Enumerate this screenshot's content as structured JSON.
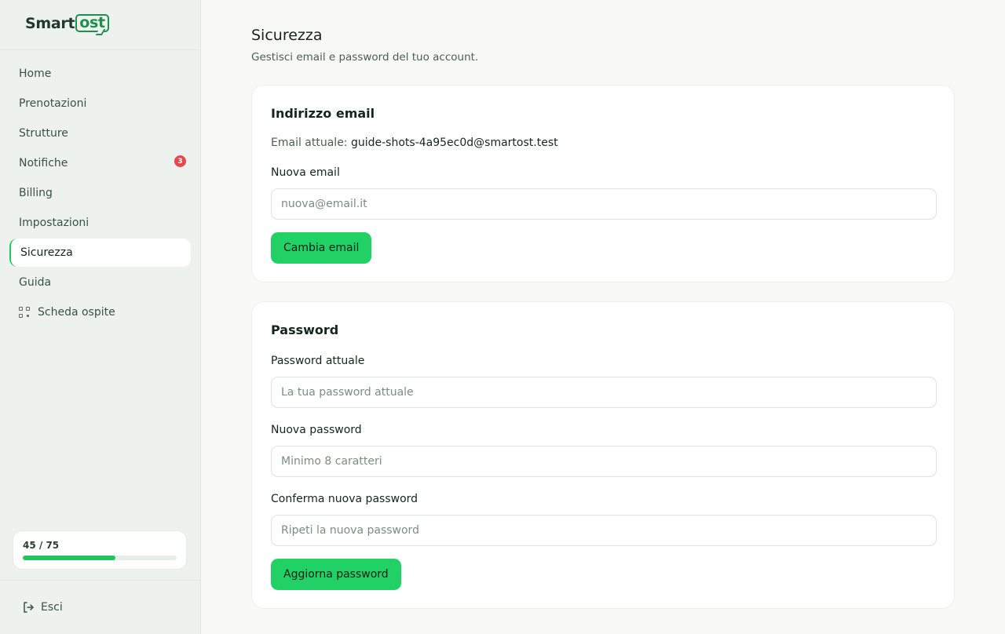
{
  "brand": {
    "name_prefix": "Smart",
    "name_boxed": "ost"
  },
  "sidebar": {
    "items": [
      {
        "label": "Home"
      },
      {
        "label": "Prenotazioni"
      },
      {
        "label": "Strutture"
      },
      {
        "label": "Notifiche",
        "badge": "3"
      },
      {
        "label": "Billing"
      },
      {
        "label": "Impostazioni"
      },
      {
        "label": "Sicurezza",
        "active": true
      },
      {
        "label": "Guida"
      },
      {
        "label": "Scheda ospite",
        "icon": "qr-code-icon"
      }
    ],
    "usage": {
      "label": "45 / 75",
      "used": 45,
      "total": 75
    },
    "logout": {
      "label": "Esci",
      "icon": "logout-icon"
    }
  },
  "page": {
    "title": "Sicurezza",
    "subtitle": "Gestisci email e password del tuo account."
  },
  "email_card": {
    "title": "Indirizzo email",
    "current_label": "Email attuale:",
    "current_value": "guide-shots-4a95ec0d@smartost.test",
    "new_label": "Nuova email",
    "new_placeholder": "nuova@email.it",
    "button": "Cambia email"
  },
  "password_card": {
    "title": "Password",
    "current_label": "Password attuale",
    "current_placeholder": "La tua password attuale",
    "new_label": "Nuova password",
    "new_placeholder": "Minimo 8 caratteri",
    "confirm_label": "Conferma nuova password",
    "confirm_placeholder": "Ripeti la nuova password",
    "button": "Aggiorna password"
  },
  "colors": {
    "accent": "#22c55e",
    "badge": "#e5484d",
    "sidebar_bg": "#eef2ee"
  }
}
